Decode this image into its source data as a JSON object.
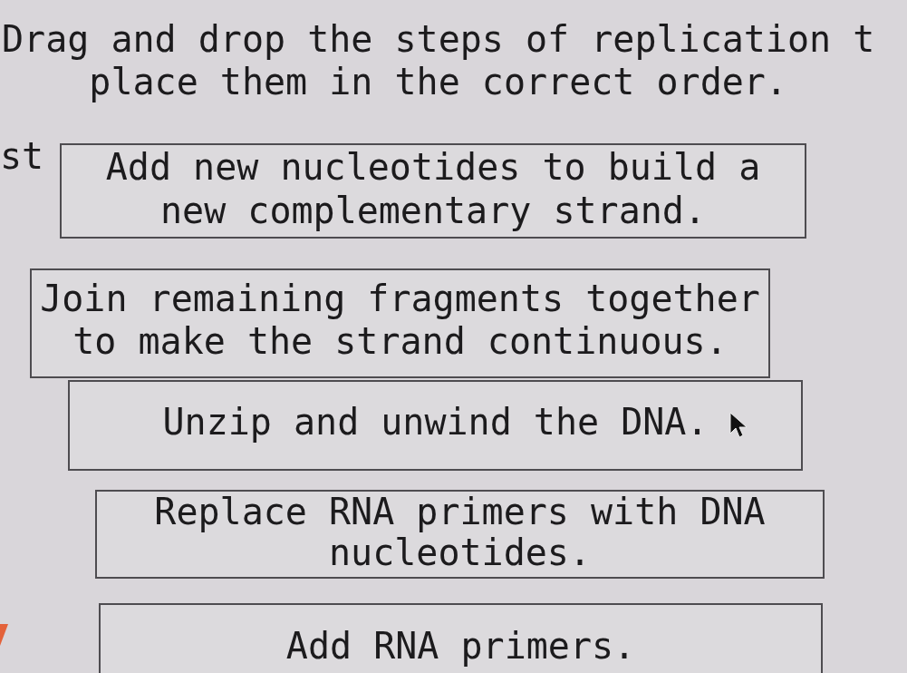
{
  "instruction": {
    "lines": [
      "Drag and drop the steps of replication t",
      "place them in the correct order."
    ]
  },
  "side_panel": {
    "text": "st"
  },
  "steps": [
    {
      "lines": [
        "Add new nucleotides to build a",
        "new complementary strand."
      ]
    },
    {
      "lines": [
        "Join remaining fragments together",
        "to make the strand continuous."
      ]
    },
    {
      "lines": [
        "Unzip and unwind the DNA."
      ]
    },
    {
      "lines": [
        "Replace RNA primers with DNA",
        "nucleotides."
      ]
    },
    {
      "lines": [
        "Add RNA primers."
      ]
    }
  ]
}
